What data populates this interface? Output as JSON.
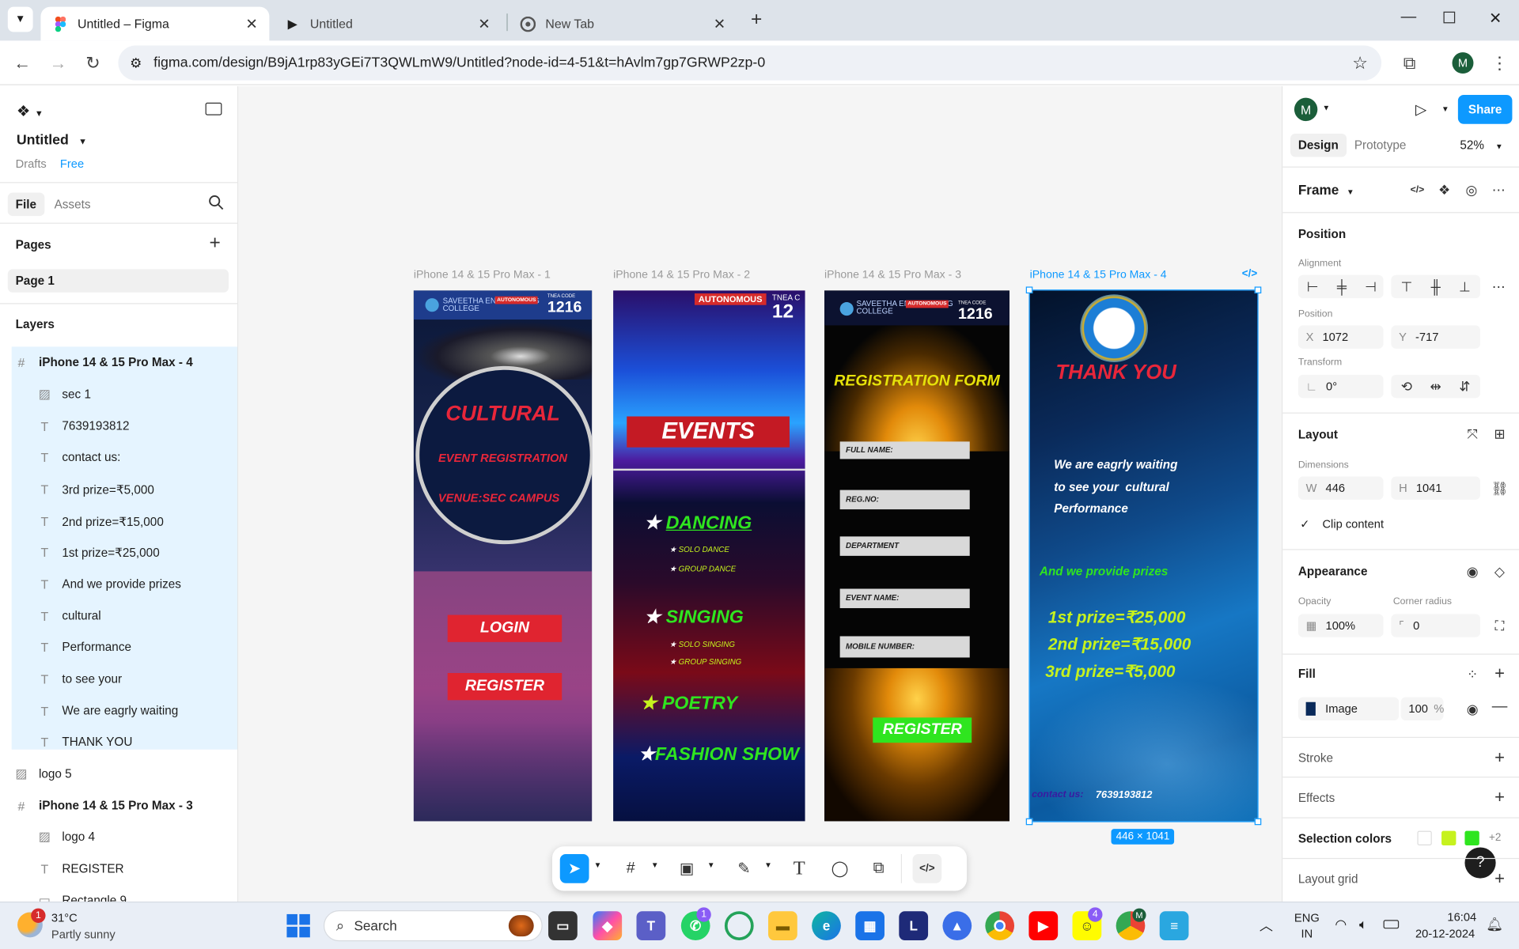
{
  "browser": {
    "tabs": [
      {
        "label": "Untitled – Figma"
      },
      {
        "label": "Untitled"
      },
      {
        "label": "New Tab"
      }
    ],
    "url": "figma.com/design/B9jA1rp83yGEi7T3QWLmW9/Untitled?node-id=4-51&t=hAvlm7gp7GRWP2zp-0",
    "profile_letter": "M"
  },
  "left": {
    "file_title": "Untitled",
    "drafts": "Drafts",
    "plan": "Free",
    "tab_file": "File",
    "tab_assets": "Assets",
    "pages_heading": "Pages",
    "page_name": "Page 1",
    "layers_heading": "Layers",
    "layers": [
      {
        "label": "iPhone 14 & 15 Pro Max - 4",
        "icon": "frame-icon"
      },
      {
        "label": "sec 1",
        "icon": "image-icon"
      },
      {
        "label": "7639193812",
        "icon": "text-icon"
      },
      {
        "label": "contact us:",
        "icon": "text-icon"
      },
      {
        "label": "3rd prize=₹5,000",
        "icon": "text-icon"
      },
      {
        "label": "2nd prize=₹15,000",
        "icon": "text-icon"
      },
      {
        "label": "1st prize=₹25,000",
        "icon": "text-icon"
      },
      {
        "label": "And we provide prizes",
        "icon": "text-icon"
      },
      {
        "label": "cultural",
        "icon": "text-icon"
      },
      {
        "label": "Performance",
        "icon": "text-icon"
      },
      {
        "label": "to see your",
        "icon": "text-icon"
      },
      {
        "label": "We are eagrly waiting",
        "icon": "text-icon"
      },
      {
        "label": "THANK YOU",
        "icon": "text-icon"
      },
      {
        "label": "logo 5",
        "icon": "image-icon"
      },
      {
        "label": "iPhone 14 & 15 Pro Max - 3",
        "icon": "frame-icon"
      },
      {
        "label": "logo 4",
        "icon": "image-icon"
      },
      {
        "label": "REGISTER",
        "icon": "text-icon"
      },
      {
        "label": "Rectangle 9",
        "icon": "rectangle-icon"
      }
    ]
  },
  "canvas": {
    "frames": [
      {
        "label": "iPhone 14 & 15 Pro Max - 1"
      },
      {
        "label": "iPhone 14 & 15 Pro Max - 2"
      },
      {
        "label": "iPhone 14 & 15 Pro Max - 3"
      },
      {
        "label": "iPhone 14 & 15 Pro Max - 4"
      }
    ],
    "size_badge": "446 × 1041",
    "f1": {
      "college": "SAVEETHA ENGINEERING COLLEGE",
      "autonomous": "AUTONOMOUS",
      "tnea": "TNEA CODE",
      "code": "1216",
      "title": "CULTURAL",
      "subtitle": "EVENT REGISTRATION",
      "venue": "VENUE:SEC CAMPUS",
      "login": "LOGIN",
      "register": "REGISTER"
    },
    "f2": {
      "autonomous": "AUTONOMOUS",
      "tnea": "TNEA C",
      "code": "12",
      "events": "EVENTS",
      "dancing": "DANCING",
      "solo_dance": "SOLO DANCE",
      "group_dance": "GROUP DANCE",
      "singing": "SINGING",
      "solo_singing": "SOLO SINGING",
      "group_singing": "GROUP SINGING",
      "poetry": "POETRY",
      "fashion": "FASHION SHOW"
    },
    "f3": {
      "college": "SAVEETHA ENGINEERING COLLEGE",
      "autonomous": "AUTONOMOUS",
      "tnea": "TNEA CODE",
      "code": "1216",
      "title": "REGISTRATION FORM",
      "fields": [
        "FULL NAME:",
        "REG.NO:",
        "DEPARTMENT",
        "EVENT NAME:",
        "MOBILE NUMBER:"
      ],
      "register": "REGISTER"
    },
    "f4": {
      "thank_you": "THANK YOU",
      "waiting_1": "We are eagrly waiting",
      "waiting_2": "to see your  cultural",
      "waiting_3": "Performance",
      "prizes_intro": "And we provide prizes",
      "prize1": "1st prize=₹25,000",
      "prize2": "2nd prize=₹15,000",
      "prize3": "3rd prize=₹5,000",
      "contact": "contact us:",
      "phone": "7639193812"
    }
  },
  "right": {
    "avatar": "M",
    "share": "Share",
    "tab_design": "Design",
    "tab_prototype": "Prototype",
    "zoom": "52%",
    "frame_type": "Frame",
    "position_heading": "Position",
    "alignment_label": "Alignment",
    "position_label": "Position",
    "x_label": "X",
    "x": "1072",
    "y_label": "Y",
    "y": "-717",
    "transform_label": "Transform",
    "rotation": "0°",
    "layout_heading": "Layout",
    "dimensions_label": "Dimensions",
    "w_label": "W",
    "w": "446",
    "h_label": "H",
    "h": "1041",
    "clip_content": "Clip content",
    "appearance_heading": "Appearance",
    "opacity_label": "Opacity",
    "opacity": "100%",
    "radius_label": "Corner radius",
    "radius": "0",
    "fill_heading": "Fill",
    "fill_type": "Image",
    "fill_opacity": "100",
    "fill_pct": "%",
    "stroke_heading": "Stroke",
    "effects_heading": "Effects",
    "selection_colors_heading": "Selection colors",
    "selection_colors": [
      "#ffffff",
      "#c6f21e",
      "#2fe51f"
    ],
    "selection_more": "+2",
    "layout_grid_heading": "Layout grid"
  },
  "taskbar": {
    "weather_temp": "31°C",
    "weather_desc": "Partly sunny",
    "weather_badge": "1",
    "search": "Search",
    "whatsapp_badge": "1",
    "snapchat_badge": "4",
    "lang": "ENG",
    "region": "IN",
    "time": "16:04",
    "date": "20-12-2024",
    "chrome_profile": "M"
  }
}
